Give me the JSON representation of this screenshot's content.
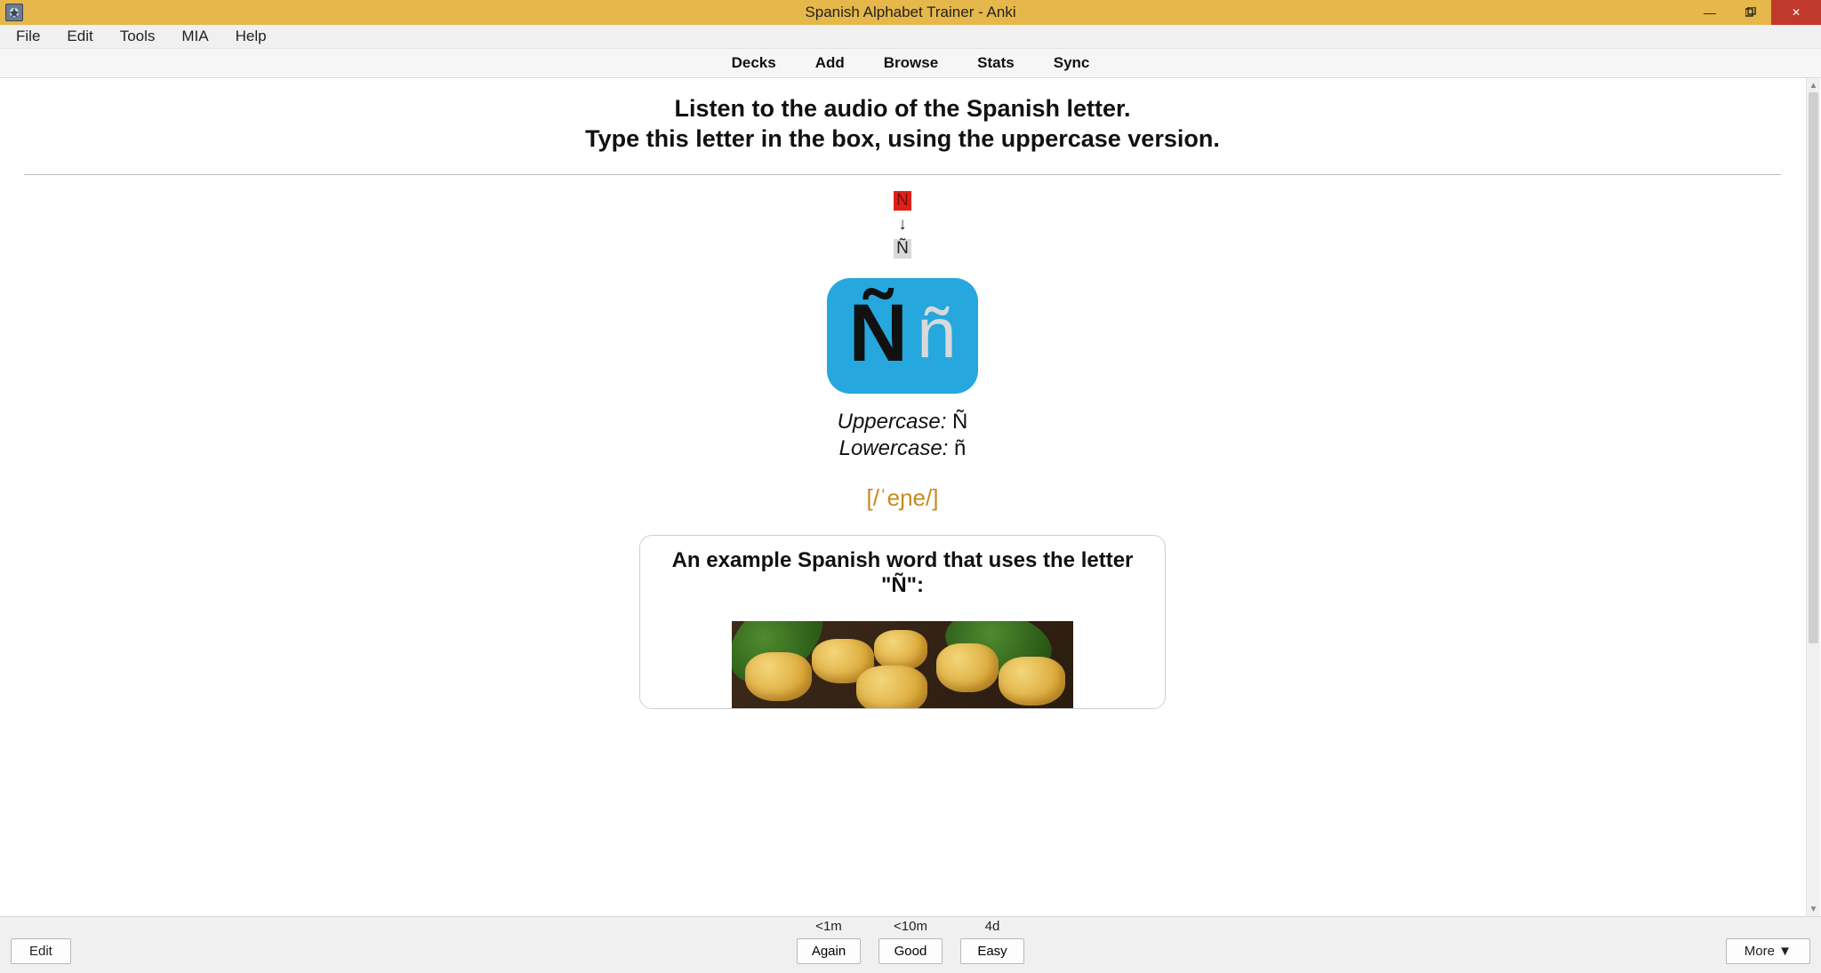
{
  "window": {
    "title": "Spanish Alphabet Trainer - Anki"
  },
  "menubar": [
    "File",
    "Edit",
    "Tools",
    "MIA",
    "Help"
  ],
  "toolbar": [
    "Decks",
    "Add",
    "Browse",
    "Stats",
    "Sync"
  ],
  "card": {
    "instruction_line1": "Listen to the audio of the Spanish letter.",
    "instruction_line2": "Type this letter in the box, using the uppercase version.",
    "typed_wrong": "N",
    "arrow": "↓",
    "correct_answer": "Ñ",
    "big_upper": "Ñ",
    "big_lower": "ñ",
    "uppercase_label": "Uppercase:",
    "uppercase_value": "Ñ",
    "lowercase_label": "Lowercase:",
    "lowercase_value": "ñ",
    "ipa": "[/ˈeɲe/]",
    "example_title": "An example Spanish word that uses the letter \"Ñ\":"
  },
  "bottom": {
    "edit": "Edit",
    "more": "More ▼",
    "answers": [
      {
        "time": "<1m",
        "label": "Again"
      },
      {
        "time": "<10m",
        "label": "Good"
      },
      {
        "time": "4d",
        "label": "Easy"
      }
    ]
  }
}
